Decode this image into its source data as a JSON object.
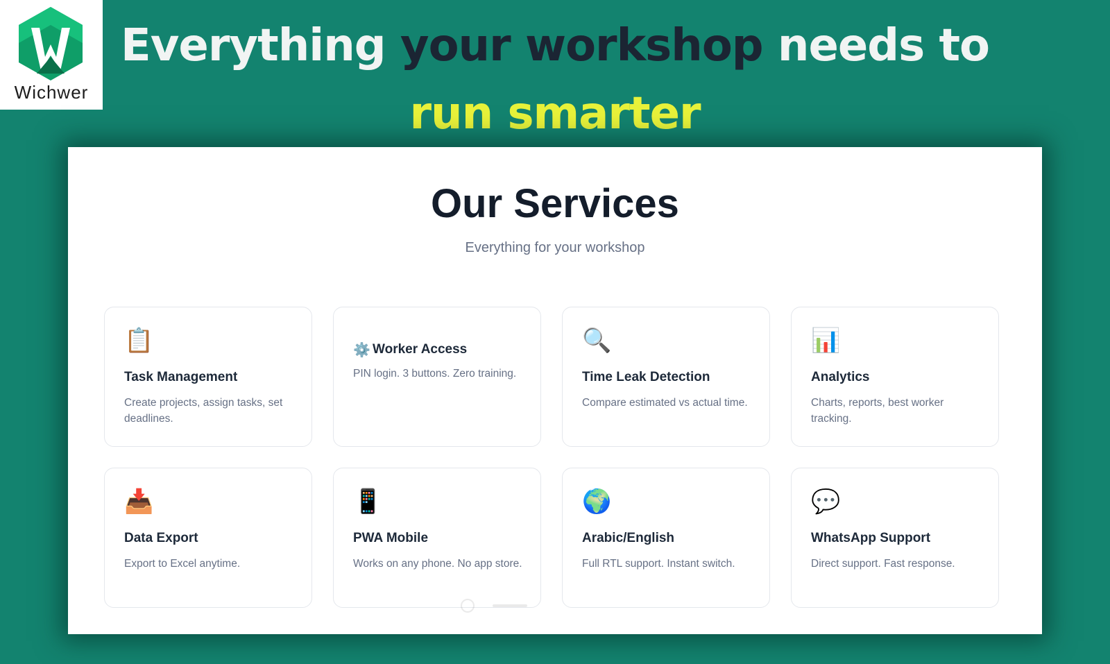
{
  "brand": {
    "name": "Wichwer",
    "colors": {
      "background": "#13836f",
      "logo_green": "#11a36a",
      "headline_highlight": "#e8f23a"
    }
  },
  "headline": {
    "part1": "Everything ",
    "part2": "your workshop",
    "part3": " needs to",
    "line2": "run smarter"
  },
  "panel": {
    "title": "Our Services",
    "subtitle": "Everything for your workshop",
    "cards": [
      {
        "icon": "clipboard-icon",
        "glyph": "📋",
        "title": "Task Management",
        "desc": "Create projects, assign tasks, set deadlines."
      },
      {
        "icon": "gear-icon",
        "glyph": "⚙️",
        "title": "Worker Access",
        "desc": "PIN login. 3 buttons. Zero training."
      },
      {
        "icon": "magnifier-icon",
        "glyph": "🔍",
        "title": "Time Leak Detection",
        "desc": "Compare estimated vs actual time."
      },
      {
        "icon": "bar-chart-icon",
        "glyph": "📊",
        "title": "Analytics",
        "desc": "Charts, reports, best worker tracking."
      },
      {
        "icon": "inbox-tray-icon",
        "glyph": "📥",
        "title": "Data Export",
        "desc": "Export to Excel anytime."
      },
      {
        "icon": "mobile-phone-icon",
        "glyph": "📱",
        "title": "PWA Mobile",
        "desc": "Works on any phone. No app store."
      },
      {
        "icon": "globe-icon",
        "glyph": "🌍",
        "title": "Arabic/English",
        "desc": "Full RTL support. Instant switch."
      },
      {
        "icon": "speech-bubble-icon",
        "glyph": "💬",
        "title": "WhatsApp Support",
        "desc": "Direct support. Fast response."
      }
    ]
  }
}
